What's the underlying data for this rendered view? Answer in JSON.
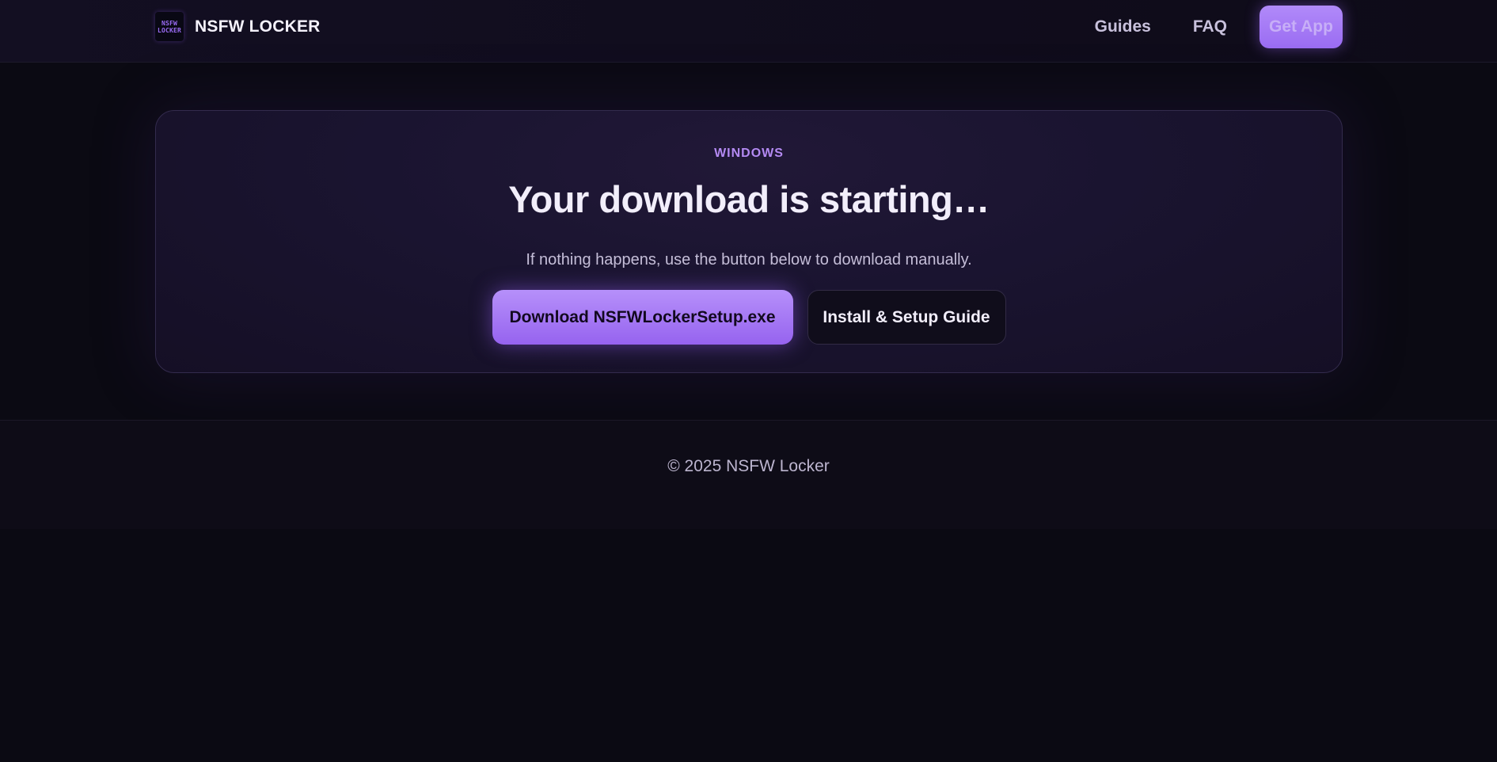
{
  "header": {
    "logo_lines": [
      "NSFW",
      "LOCKER"
    ],
    "brand_name": "NSFW LOCKER",
    "nav": {
      "guides": "Guides",
      "faq": "FAQ",
      "get_app": "Get App"
    }
  },
  "hero": {
    "eyebrow": "WINDOWS",
    "title": "Your download is starting…",
    "subtitle": "If nothing happens, use the button below to download manually.",
    "primary_button": "Download NSFWLockerSetup.exe",
    "secondary_button": "Install & Setup Guide"
  },
  "footer": {
    "copyright": "© 2025 NSFW Locker"
  },
  "colors": {
    "accent": "#a27af5",
    "background": "#0b0a13",
    "card": "#1a1430"
  }
}
